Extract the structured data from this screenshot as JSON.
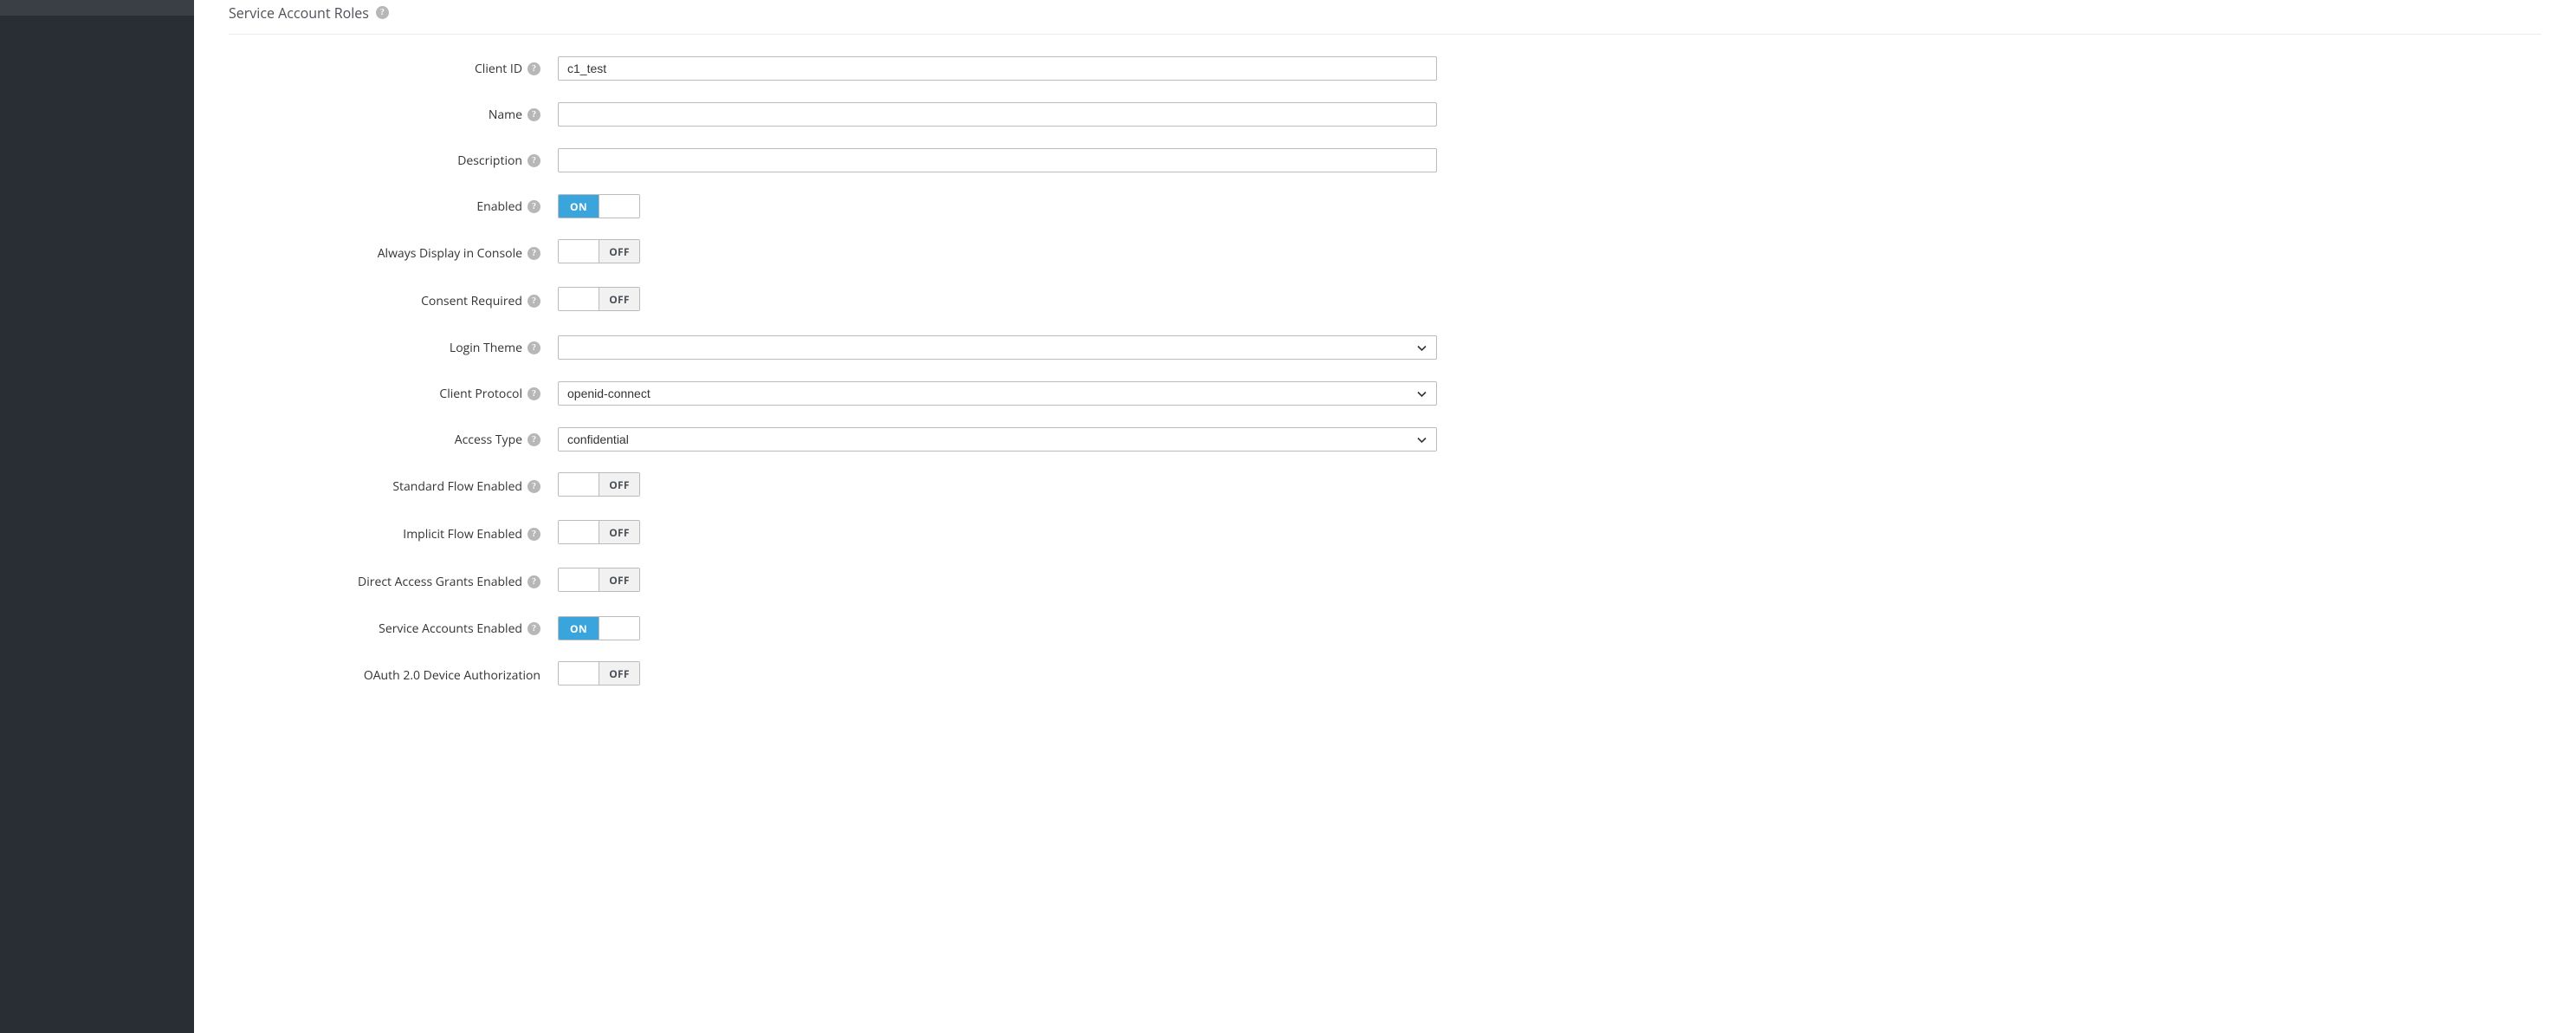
{
  "header": {
    "tab_title": "Service Account Roles"
  },
  "toggle_labels": {
    "on": "ON",
    "off": "OFF"
  },
  "fields": {
    "client_id": {
      "label": "Client ID",
      "value": "c1_test"
    },
    "name": {
      "label": "Name",
      "value": ""
    },
    "description": {
      "label": "Description",
      "value": ""
    },
    "enabled": {
      "label": "Enabled",
      "value": true
    },
    "always_display": {
      "label": "Always Display in Console",
      "value": false
    },
    "consent_required": {
      "label": "Consent Required",
      "value": false
    },
    "login_theme": {
      "label": "Login Theme",
      "value": ""
    },
    "client_protocol": {
      "label": "Client Protocol",
      "value": "openid-connect"
    },
    "access_type": {
      "label": "Access Type",
      "value": "confidential"
    },
    "standard_flow": {
      "label": "Standard Flow Enabled",
      "value": false
    },
    "implicit_flow": {
      "label": "Implicit Flow Enabled",
      "value": false
    },
    "direct_access": {
      "label": "Direct Access Grants Enabled",
      "value": false
    },
    "service_accounts": {
      "label": "Service Accounts Enabled",
      "value": true
    },
    "oauth2_device": {
      "label": "OAuth 2.0 Device Authorization",
      "value": false
    }
  }
}
